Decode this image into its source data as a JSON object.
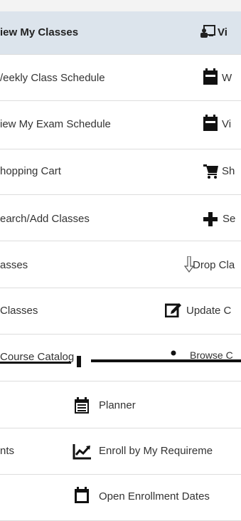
{
  "menu": {
    "rows": [
      {
        "left_label": "iew My Classes",
        "right_label": "Vi",
        "right_icon": "view-classes-icon",
        "selected": true
      },
      {
        "left_label": "/eekly Class Schedule",
        "right_label": "W",
        "right_icon": "calendar-icon"
      },
      {
        "left_label": "iew My Exam Schedule",
        "right_label": "Vi",
        "right_icon": "calendar-icon"
      },
      {
        "left_label": "hopping Cart",
        "right_label": "Sh",
        "right_icon": "cart-icon"
      },
      {
        "left_label": "earch/Add Classes",
        "right_label": "Se",
        "right_icon": "plus-icon"
      },
      {
        "left_label": "asses",
        "right_label": "Drop Cla",
        "right_icon": "drop-arrow-icon"
      },
      {
        "left_label": "Classes",
        "right_label": "Update C",
        "right_icon": "edit-icon"
      },
      {
        "left_label": "Course Catalog",
        "right_label": "Browse C",
        "right_icon": "book-icon"
      },
      {
        "left_label": "",
        "right_label": "Planner",
        "right_icon": "planner-icon"
      },
      {
        "left_label": "nts",
        "right_label": "Enroll by My Requireme",
        "right_icon": "chart-icon"
      },
      {
        "left_label": "",
        "right_label": "Open Enrollment Dates",
        "right_icon": "calendar-outline-icon"
      }
    ]
  }
}
